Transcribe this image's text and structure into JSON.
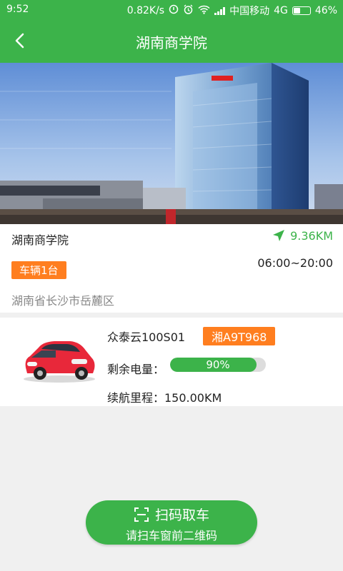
{
  "status_bar": {
    "time": "9:52",
    "speed": "0.82K/s",
    "carrier": "中国移动",
    "network": "4G",
    "battery": "46%",
    "battery_level": 0.46
  },
  "header": {
    "title": "湖南商学院"
  },
  "station": {
    "name": "湖南商学院",
    "distance": "9.36KM",
    "vehicle_count": "车辆1台",
    "hours": "06:00~20:00",
    "address": "湖南省长沙市岳麓区"
  },
  "car": {
    "model": "众泰云100S01",
    "plate": "湘A9T968",
    "battery_label": "剩余电量：",
    "battery_percent_text": "90%",
    "battery_level": 0.9,
    "range": "续航里程：150.00KM"
  },
  "scan_button": {
    "label": "扫码取车",
    "subtitle": "请扫车窗前二维码"
  },
  "colors": {
    "primary": "#3cb34a",
    "accent": "#ff7e1f"
  }
}
